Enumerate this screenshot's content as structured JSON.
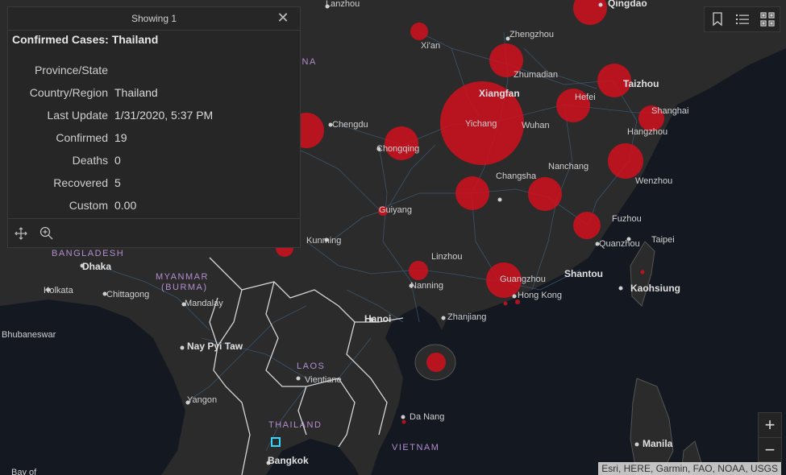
{
  "popup": {
    "header": "Showing 1",
    "title": "Confirmed Cases: Thailand",
    "fields": [
      {
        "label": "Province/State",
        "value": ""
      },
      {
        "label": "Country/Region",
        "value": "Thailand"
      },
      {
        "label": "Last Update",
        "value": "1/31/2020, 5:37 PM"
      },
      {
        "label": "Confirmed",
        "value": "19"
      },
      {
        "label": "Deaths",
        "value": "0"
      },
      {
        "label": "Recovered",
        "value": "5"
      },
      {
        "label": "Custom",
        "value": "0.00"
      }
    ]
  },
  "toolbar": {
    "icons": [
      "bookmark-icon",
      "list-icon",
      "qr-code-icon"
    ]
  },
  "zoom": {
    "in": "+",
    "out": "−"
  },
  "attribution": "Esri, HERE, Garmin, FAO, NOAA, USGS",
  "colors": {
    "bubble": "#d0101f",
    "land": "#2a2a2a",
    "water": "#141820",
    "border": "#cfcfcf",
    "road": "#3c5c78",
    "selection": "#33d6ff"
  },
  "map_labels": {
    "cities": [
      "Lanzhou",
      "Qingdao",
      "Xi'an",
      "Zhengzhou",
      "Zhumadian",
      "Xiangfan",
      "Taizhou",
      "Hefei",
      "Shanghai",
      "Chengdu",
      "Yichang",
      "Wuhan",
      "Hangzhou",
      "Chongqing",
      "Changsha",
      "Nanchang",
      "Wenzhou",
      "Guiyang",
      "Fuzhou",
      "Kunming",
      "Linzhou",
      "Quanzhou",
      "Taipei",
      "Dhaka",
      "Shantou",
      "Kolkata",
      "Nanning",
      "Guangzhou",
      "Kaohsiung",
      "Chittagong",
      "Mandalay",
      "Hong Kong",
      "Hanoi",
      "Zhanjiang",
      "Nay Pyi Taw",
      "Vientiane",
      "Yangon",
      "Da Nang",
      "Bangkok",
      "Manila",
      "Bhubaneswar",
      "Bay of"
    ],
    "countries": [
      "INA",
      "BANGLADESH",
      "MYANMAR",
      "(BURMA)",
      "LAOS",
      "THAILAND",
      "VIETNAM"
    ]
  }
}
